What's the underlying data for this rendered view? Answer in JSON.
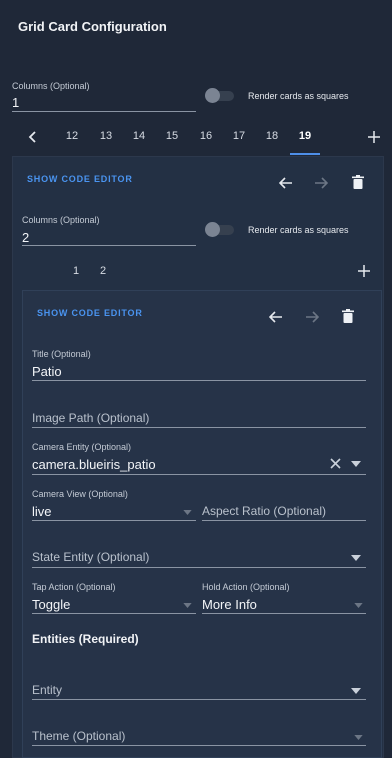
{
  "header": {
    "title": "Grid Card Configuration"
  },
  "outer": {
    "columns_label": "Columns (Optional)",
    "columns_value": "1",
    "square_label": "Render cards as squares",
    "tabs": [
      "12",
      "13",
      "14",
      "15",
      "16",
      "17",
      "18",
      "19"
    ],
    "active_tab": "19",
    "show_code_editor": "SHOW CODE EDITOR"
  },
  "inner": {
    "columns_label": "Columns (Optional)",
    "columns_value": "2",
    "square_label": "Render cards as squares",
    "tabs": [
      "1",
      "2"
    ],
    "show_code_editor": "SHOW CODE EDITOR"
  },
  "card": {
    "title_label": "Title (Optional)",
    "title_value": "Patio",
    "image_path_placeholder": "Image Path (Optional)",
    "camera_entity_label": "Camera Entity (Optional)",
    "camera_entity_value": "camera.blueiris_patio",
    "camera_view_label": "Camera View (Optional)",
    "camera_view_value": "live",
    "aspect_ratio_placeholder": "Aspect Ratio (Optional)",
    "state_entity_placeholder": "State Entity (Optional)",
    "tap_action_label": "Tap Action (Optional)",
    "tap_action_value": "Toggle",
    "hold_action_label": "Hold Action (Optional)",
    "hold_action_value": "More Info",
    "entities_heading": "Entities (Required)",
    "entity_placeholder": "Entity",
    "theme_placeholder": "Theme (Optional)"
  },
  "colors": {
    "accent": "#4a94f0",
    "background": "#1f2838"
  }
}
